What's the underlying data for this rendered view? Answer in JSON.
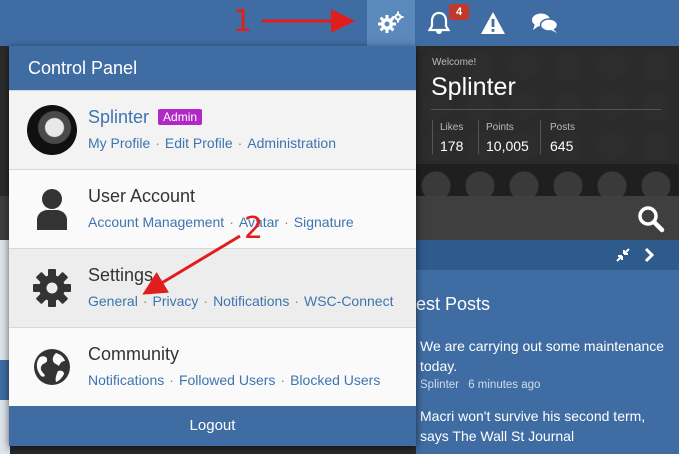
{
  "topbar": {
    "notification_count": "4",
    "icons": [
      "cog-icon",
      "bell-icon",
      "warning-icon",
      "chat-icon"
    ]
  },
  "annotations": {
    "one": "1",
    "two": "2",
    "color": "#e01e1e"
  },
  "hero": {
    "welcome": "Welcome!",
    "name": "Splinter",
    "stats": [
      {
        "label": "Likes",
        "value": "178"
      },
      {
        "label": "Points",
        "value": "10,005"
      },
      {
        "label": "Posts",
        "value": "645"
      }
    ]
  },
  "latest": {
    "title": "est Posts",
    "posts": [
      {
        "title": "We are carrying out some maintenance today.",
        "author": "Splinter",
        "time": "6 minutes ago"
      },
      {
        "title": "Macri won't survive his second term, says The Wall St Journal"
      }
    ]
  },
  "control_panel": {
    "title": "Control Panel",
    "user": {
      "name": "Splinter",
      "badge": "Admin",
      "links": [
        "My Profile",
        "Edit Profile",
        "Administration"
      ]
    },
    "account": {
      "title": "User Account",
      "links": [
        "Account Management",
        "Avatar",
        "Signature"
      ]
    },
    "settings": {
      "title": "Settings",
      "links": [
        "General",
        "Privacy",
        "Notifications",
        "WSC-Connect"
      ]
    },
    "community": {
      "title": "Community",
      "links": [
        "Notifications",
        "Followed Users",
        "Blocked Users"
      ]
    },
    "logout": "Logout"
  },
  "colors": {
    "brand_blue": "#3f6da3",
    "link_blue": "#3e74b0",
    "admin_badge": "#b128c7",
    "notification_badge": "#c0392b"
  }
}
